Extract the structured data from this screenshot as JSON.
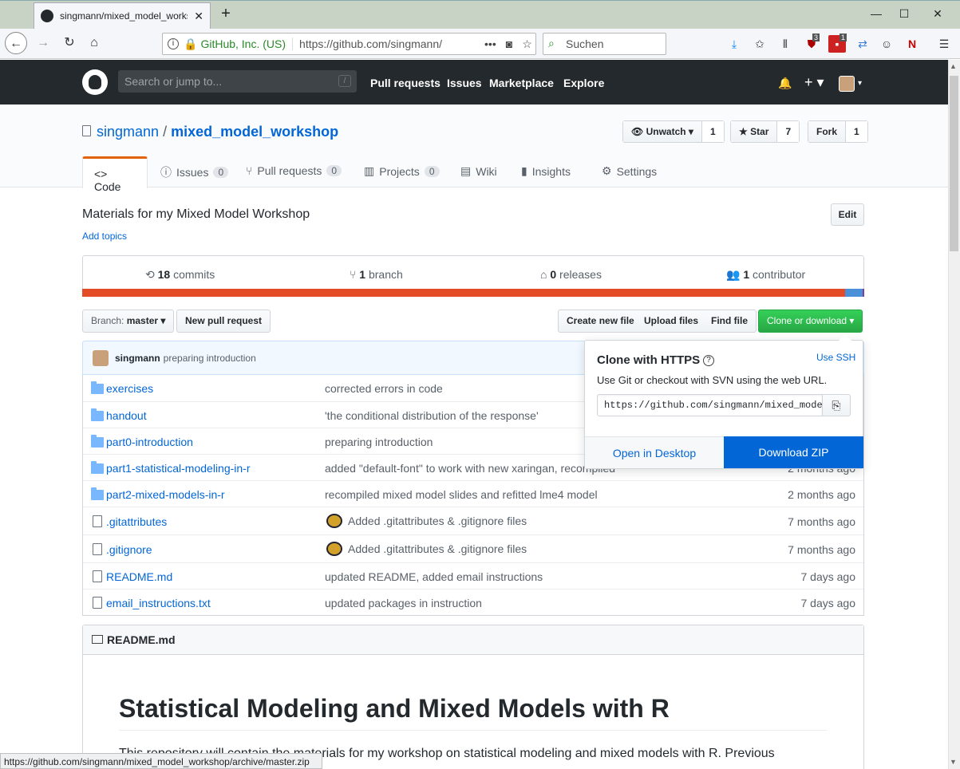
{
  "browser": {
    "tab_title": "singmann/mixed_model_works",
    "new_tab": "+",
    "org": "GitHub, Inc. (US)",
    "url": "https://github.com/singmann/",
    "search_placeholder": "Suchen",
    "page_actions": "•••",
    "badge1": "3",
    "badge2": "1",
    "status_url": "https://github.com/singmann/mixed_model_workshop/archive/master.zip"
  },
  "github": {
    "search_placeholder": "Search or jump to...",
    "search_key": "/",
    "nav": [
      "Pull requests",
      "Issues",
      "Marketplace",
      "Explore"
    ]
  },
  "repo": {
    "owner": "singmann",
    "separator": "/",
    "name": "mixed_model_workshop",
    "watch": {
      "label": "Unwatch",
      "count": "1"
    },
    "star": {
      "label": "Star",
      "count": "7"
    },
    "fork": {
      "label": "Fork",
      "count": "1"
    },
    "tabs": [
      {
        "label": "Code"
      },
      {
        "label": "Issues",
        "count": "0"
      },
      {
        "label": "Pull requests",
        "count": "0"
      },
      {
        "label": "Projects",
        "count": "0"
      },
      {
        "label": "Wiki"
      },
      {
        "label": "Insights"
      },
      {
        "label": "Settings"
      }
    ],
    "description": "Materials for my Mixed Model Workshop",
    "add_topics": "Add topics",
    "edit": "Edit",
    "summary": {
      "commits_n": "18",
      "commits": "commits",
      "branch_n": "1",
      "branch": "branch",
      "releases_n": "0",
      "releases": "releases",
      "contrib_n": "1",
      "contrib": "contributor"
    },
    "branch_label": "Branch:",
    "branch_value": "master",
    "new_pr": "New pull request",
    "create_file": "Create new file",
    "upload_files": "Upload files",
    "find_file": "Find file",
    "clone": "Clone or download",
    "latest_commit": {
      "author": "singmann",
      "message": "preparing introduction"
    },
    "files": [
      {
        "name": "exercises",
        "message": "corrected errors in code",
        "age": ""
      },
      {
        "name": "handout",
        "message": "'the conditional distribution of the response'",
        "age": ""
      },
      {
        "name": "part0-introduction",
        "message": "preparing introduction",
        "age": ""
      },
      {
        "name": "part1-statistical-modeling-in-r",
        "message": "added \"default-font\" to work with new xaringan, recompiled",
        "age": "2 months ago"
      },
      {
        "name": "part2-mixed-models-in-r",
        "message": "recompiled mixed model slides and refitted lme4 model",
        "age": "2 months ago"
      },
      {
        "name": ".gitattributes",
        "message": "Added .gitattributes & .gitignore files",
        "age": "7 months ago"
      },
      {
        "name": ".gitignore",
        "message": "Added .gitattributes & .gitignore files",
        "age": "7 months ago"
      },
      {
        "name": "README.md",
        "message": "updated README, added email instructions",
        "age": "7 days ago"
      },
      {
        "name": "email_instructions.txt",
        "message": "updated packages in instruction",
        "age": "7 days ago"
      }
    ],
    "readme": {
      "file": "README.md",
      "title": "Statistical Modeling and Mixed Models with R",
      "text": "This repository will contain the materials for my workshop on statistical modeling and mixed models with R. Previous"
    }
  },
  "clone_dd": {
    "title": "Clone with HTTPS",
    "help": "?",
    "use_ssh": "Use SSH",
    "desc": "Use Git or checkout with SVN using the web URL.",
    "url": "https://github.com/singmann/mixed_model_workshop.git",
    "open_desktop": "Open in Desktop",
    "download_zip": "Download ZIP"
  },
  "colors": {
    "header": "#24292e",
    "link": "#0366d6",
    "green": "#28a745",
    "accent": "#e36209"
  }
}
